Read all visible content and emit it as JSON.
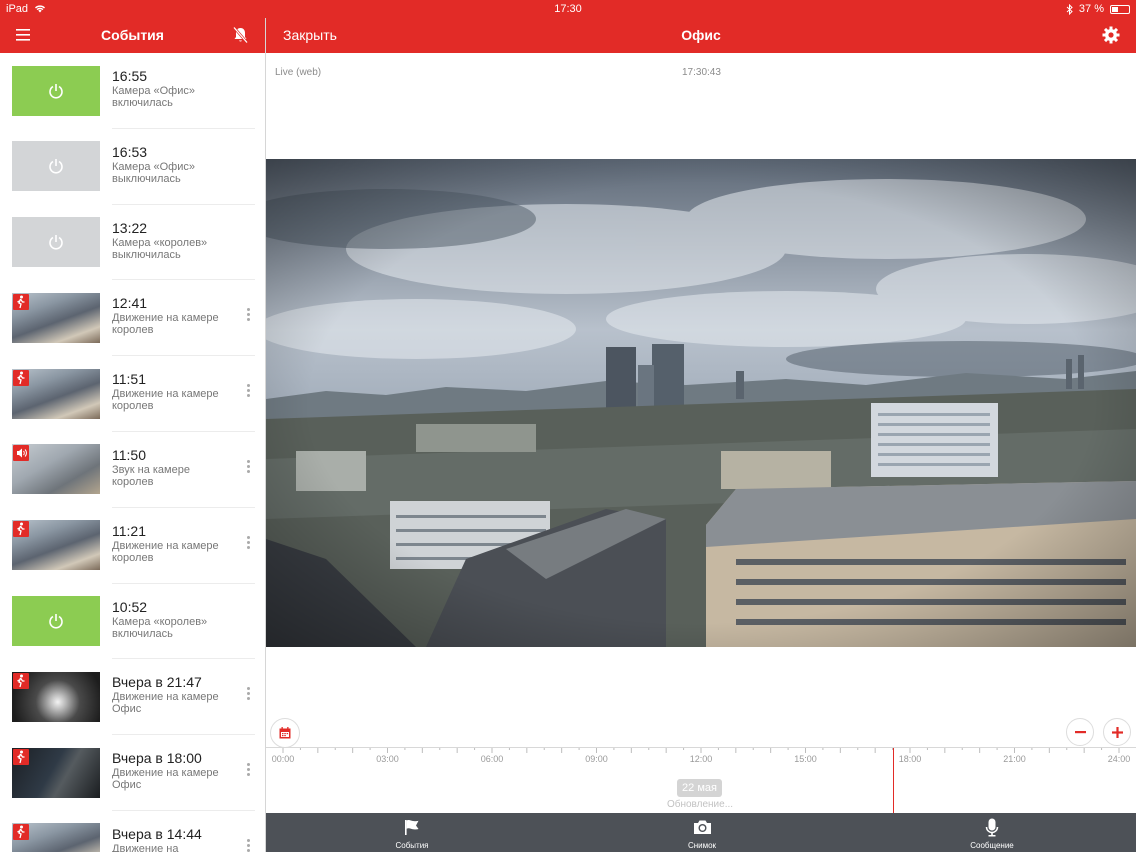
{
  "status_bar": {
    "device": "iPad",
    "time": "17:30",
    "battery": "37 %"
  },
  "left_header": {
    "title": "События",
    "menu_icon": "hamburger-icon",
    "mute_icon": "bell-off-icon"
  },
  "right_header": {
    "close_label": "Закрыть",
    "title": "Офис",
    "settings_icon": "gear-icon"
  },
  "events": [
    {
      "time": "16:55",
      "desc": "Камера «Офис» включилась",
      "thumb": "on",
      "icon": "power-icon",
      "has_menu": false
    },
    {
      "time": "16:53",
      "desc": "Камера «Офис» выключилась",
      "thumb": "off",
      "icon": "power-icon",
      "has_menu": false
    },
    {
      "time": "13:22",
      "desc": "Камера «королев» выключилась",
      "thumb": "off",
      "icon": "power-icon",
      "has_menu": false
    },
    {
      "time": "12:41",
      "desc": "Движение на камере королев",
      "thumb": "cam",
      "icon": "motion-icon",
      "has_menu": true
    },
    {
      "time": "11:51",
      "desc": "Движение на камере королев",
      "thumb": "cam",
      "icon": "motion-icon",
      "has_menu": true
    },
    {
      "time": "11:50",
      "desc": "Звук на камере королев",
      "thumb": "cam2",
      "icon": "sound-icon",
      "has_menu": true
    },
    {
      "time": "11:21",
      "desc": "Движение на камере королев",
      "thumb": "cam",
      "icon": "motion-icon",
      "has_menu": true
    },
    {
      "time": "10:52",
      "desc": "Камера «королев» включилась",
      "thumb": "on",
      "icon": "power-icon",
      "has_menu": false
    },
    {
      "time": "Вчера в 21:47",
      "desc": "Движение на камере Офис",
      "thumb": "dark",
      "icon": "motion-icon",
      "has_menu": true
    },
    {
      "time": "Вчера в 18:00",
      "desc": "Движение на камере Офис",
      "thumb": "dark2",
      "icon": "motion-icon",
      "has_menu": true
    },
    {
      "time": "Вчера в 14:44",
      "desc": "Движение на",
      "thumb": "cam",
      "icon": "motion-icon",
      "has_menu": true
    }
  ],
  "player": {
    "source_label": "Live (web)",
    "timestamp": "17:30:43"
  },
  "timeline": {
    "ticks": [
      "00:00",
      "03:00",
      "06:00",
      "09:00",
      "12:00",
      "15:00",
      "18:00",
      "21:00",
      "24:00"
    ],
    "date_label": "22 мая",
    "status_text": "Обновление...",
    "calendar_icon": "calendar-icon",
    "zoom_out_icon": "minus-icon",
    "zoom_in_icon": "plus-icon"
  },
  "tabs": [
    {
      "label": "События",
      "icon": "flag-icon"
    },
    {
      "label": "Снимок",
      "icon": "camera-icon"
    },
    {
      "label": "Сообщение",
      "icon": "microphone-icon"
    }
  ],
  "colors": {
    "brand_red": "#e22b27",
    "power_on": "#8ccc52",
    "power_off": "#d3d5d7",
    "tabbar": "#4d5157"
  }
}
